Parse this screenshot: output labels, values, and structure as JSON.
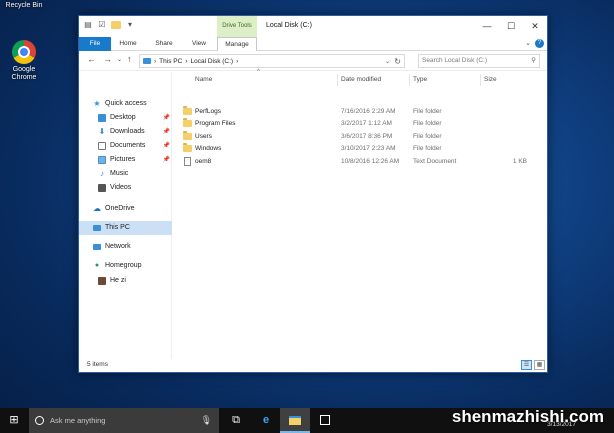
{
  "desktop": {
    "icons": [
      {
        "label": "Recycle Bin"
      },
      {
        "label": "Google Chrome"
      }
    ]
  },
  "window": {
    "title": "Local Disk (C:)",
    "contextual_tab_group": "Drive Tools",
    "controls": {
      "minimize": "—",
      "maximize": "☐",
      "close": "✕"
    }
  },
  "ribbon": {
    "tabs": [
      {
        "label": "File"
      },
      {
        "label": "Home"
      },
      {
        "label": "Share"
      },
      {
        "label": "View"
      },
      {
        "label": "Manage"
      }
    ],
    "help": "?"
  },
  "address": {
    "crumbs": [
      "This PC",
      "Local Disk (C:)"
    ],
    "separator": "›",
    "search_placeholder": "Search Local Disk (C:)"
  },
  "nav": {
    "items": [
      {
        "label": "Quick access",
        "icon": "star-icon",
        "pinned": false,
        "selected": false
      },
      {
        "label": "Desktop",
        "icon": "desktop-icon",
        "pinned": true,
        "selected": false
      },
      {
        "label": "Downloads",
        "icon": "download-icon",
        "pinned": true,
        "selected": false
      },
      {
        "label": "Documents",
        "icon": "documents-icon",
        "pinned": true,
        "selected": false
      },
      {
        "label": "Pictures",
        "icon": "pictures-icon",
        "pinned": true,
        "selected": false
      },
      {
        "label": "Music",
        "icon": "music-icon",
        "pinned": false,
        "selected": false
      },
      {
        "label": "Videos",
        "icon": "videos-icon",
        "pinned": false,
        "selected": false
      },
      {
        "label": "OneDrive",
        "icon": "cloud-icon",
        "pinned": false,
        "selected": false
      },
      {
        "label": "This PC",
        "icon": "computer-icon",
        "pinned": false,
        "selected": true
      },
      {
        "label": "Network",
        "icon": "network-icon",
        "pinned": false,
        "selected": false
      },
      {
        "label": "Homegroup",
        "icon": "homegroup-icon",
        "pinned": false,
        "selected": false
      },
      {
        "label": "He zi",
        "icon": "user-icon",
        "pinned": false,
        "selected": false
      }
    ]
  },
  "columns": [
    {
      "label": "Name"
    },
    {
      "label": "Date modified"
    },
    {
      "label": "Type"
    },
    {
      "label": "Size"
    }
  ],
  "files": [
    {
      "name": "PerfLogs",
      "date": "7/16/2016 2:29 AM",
      "type": "File folder",
      "size": "",
      "kind": "folder"
    },
    {
      "name": "Program Files",
      "date": "3/2/2017 1:12 AM",
      "type": "File folder",
      "size": "",
      "kind": "folder"
    },
    {
      "name": "Users",
      "date": "3/6/2017 8:36 PM",
      "type": "File folder",
      "size": "",
      "kind": "folder"
    },
    {
      "name": "Windows",
      "date": "3/10/2017 2:23 AM",
      "type": "File folder",
      "size": "",
      "kind": "folder"
    },
    {
      "name": "oem8",
      "date": "10/8/2016 12:26 AM",
      "type": "Text Document",
      "size": "1 KB",
      "kind": "file"
    }
  ],
  "status": {
    "item_count": "5 items"
  },
  "taskbar": {
    "search_placeholder": "Ask me anything",
    "clock_date": "3/13/2017"
  },
  "watermark": "shenmazhishi.com"
}
